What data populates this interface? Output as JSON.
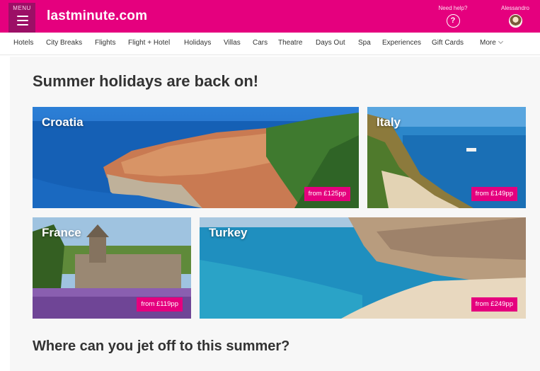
{
  "header": {
    "menu_label": "MENU",
    "logo": "lastminute.com",
    "help_label": "Need help?",
    "user_label": "Alessandro"
  },
  "nav": {
    "items": [
      "Hotels",
      "City Breaks",
      "Flights",
      "Flight + Hotel",
      "Holidays",
      "Villas",
      "Cars",
      "Theatre",
      "Days Out",
      "Spa",
      "Experiences",
      "Gift Cards",
      "More"
    ]
  },
  "main": {
    "heading": "Summer holidays are back on!",
    "subheading": "Where can you jet off to this summer?",
    "destinations": [
      {
        "name": "Croatia",
        "price": "from £125pp"
      },
      {
        "name": "Italy",
        "price": "from £149pp"
      },
      {
        "name": "France",
        "price": "from £119pp"
      },
      {
        "name": "Turkey",
        "price": "from £249pp"
      }
    ]
  },
  "colors": {
    "brand": "#e5007e",
    "menu_block": "#9c0f66",
    "text_dark": "#333333"
  }
}
